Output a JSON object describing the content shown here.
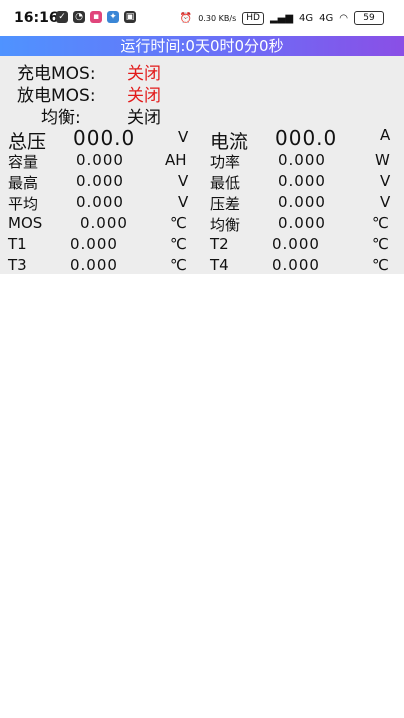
{
  "statusbar": {
    "time": "16:16",
    "net_speed": "0.30 KB/s",
    "hd_badge": "HD",
    "network_1": "4G",
    "network_2": "4G",
    "battery": "59"
  },
  "banner": {
    "text": "运行时间:0天0时0分0秒"
  },
  "switches": {
    "charge_mos": {
      "label": "充电MOS:",
      "value": "关闭"
    },
    "discharge_mos": {
      "label": "放电MOS:",
      "value": "关闭"
    },
    "balance": {
      "label": "均衡:",
      "value": "关闭"
    }
  },
  "metrics": {
    "total_voltage": {
      "label": "总压",
      "value": "000.0",
      "unit": "V"
    },
    "current": {
      "label": "电流",
      "value": "000.0",
      "unit": "A"
    },
    "capacity": {
      "label": "容量",
      "value": "0.000",
      "unit": "AH"
    },
    "power": {
      "label": "功率",
      "value": "0.000",
      "unit": "W"
    },
    "max": {
      "label": "最高",
      "value": "0.000",
      "unit": "V"
    },
    "min": {
      "label": "最低",
      "value": "0.000",
      "unit": "V"
    },
    "avg": {
      "label": "平均",
      "value": "0.000",
      "unit": "V"
    },
    "diff": {
      "label": "压差",
      "value": "0.000",
      "unit": "V"
    },
    "mos_temp": {
      "label": "MOS",
      "value": "0.000",
      "unit": "℃"
    },
    "balance_temp": {
      "label": "均衡",
      "value": "0.000",
      "unit": "℃"
    },
    "t1": {
      "label": "T1",
      "value": "0.000",
      "unit": "℃"
    },
    "t2": {
      "label": "T2",
      "value": "0.000",
      "unit": "℃"
    },
    "t3": {
      "label": "T3",
      "value": "0.000",
      "unit": "℃"
    },
    "t4": {
      "label": "T4",
      "value": "0.000",
      "unit": "℃"
    }
  },
  "colors": {
    "banner_start": "#4f93ff",
    "banner_end": "#8a4fe6",
    "off_status": "#e21b1b",
    "panel_bg": "#ededed"
  }
}
